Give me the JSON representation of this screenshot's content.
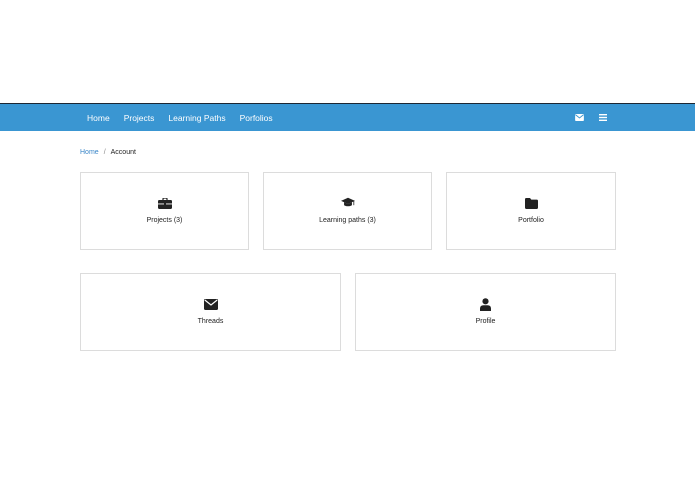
{
  "nav": {
    "links": [
      "Home",
      "Projects",
      "Learning Paths",
      "Porfolios"
    ],
    "icons": [
      "envelope-icon",
      "menu-icon"
    ]
  },
  "breadcrumb": {
    "home": "Home",
    "separator": "/",
    "current": "Account"
  },
  "cards": [
    {
      "label": "Projects (3)",
      "icon": "briefcase-icon"
    },
    {
      "label": "Learning paths (3)",
      "icon": "graduation-cap-icon"
    },
    {
      "label": "Portfolio",
      "icon": "folder-icon"
    },
    {
      "label": "Threads",
      "icon": "envelope-icon"
    },
    {
      "label": "Profile",
      "icon": "user-icon"
    }
  ],
  "colors": {
    "navbar": "#3a96d2",
    "link": "#3a86c8",
    "icon": "#222222"
  }
}
